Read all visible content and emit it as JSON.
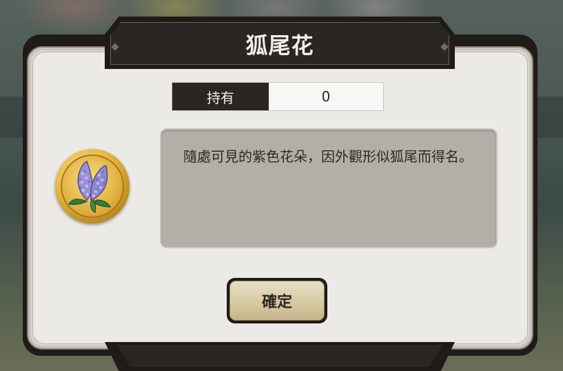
{
  "dialog": {
    "title": "狐尾花",
    "owned_label": "持有",
    "owned_value": "0",
    "description": "隨處可見的紫色花朵，因外觀形似狐尾而得名。",
    "confirm_label": "確定"
  },
  "item": {
    "icon": "purple-foxtail-flower-icon"
  },
  "colors": {
    "frame": "#1e1b19",
    "panel": "#ebeae6",
    "description_box": "#b3afa8",
    "medal_gold": "#e7b93e",
    "flower_purple": "#8f86cf"
  }
}
